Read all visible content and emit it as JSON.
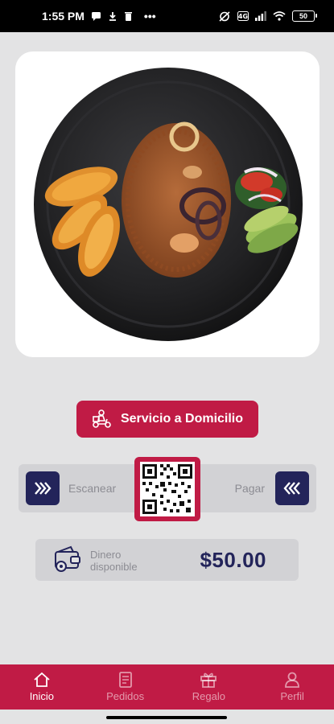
{
  "status_bar": {
    "time": "1:55 PM",
    "more": "•••",
    "battery": "50",
    "icons": [
      "message-icon",
      "download-icon",
      "trash-icon",
      "vibrate-icon",
      "data-icon",
      "signal-icon",
      "wifi-icon",
      "battery-icon"
    ]
  },
  "hero": {
    "image": "food-plate-photo"
  },
  "delivery_button": {
    "label": "Servicio a Domicilio",
    "icon": "delivery-scooter-icon"
  },
  "scan": {
    "scan_label": "Escanear",
    "pay_label": "Pagar",
    "left_icon": "chevrons-right-icon",
    "right_icon": "chevrons-left-icon",
    "qr_icon": "qr-code-icon"
  },
  "balance": {
    "label": "Dinero disponible",
    "amount": "$50.00",
    "icon": "wallet-icon"
  },
  "nav": {
    "items": [
      {
        "label": "Inicio",
        "icon": "home-icon",
        "active": true
      },
      {
        "label": "Pedidos",
        "icon": "orders-icon",
        "active": false
      },
      {
        "label": "Regalo",
        "icon": "gift-icon",
        "active": false
      },
      {
        "label": "Perfil",
        "icon": "profile-icon",
        "active": false
      }
    ]
  },
  "colors": {
    "brand_red": "#c01b45",
    "navy": "#23245a",
    "background": "#e3e3e4",
    "panel": "#d2d2d5"
  }
}
